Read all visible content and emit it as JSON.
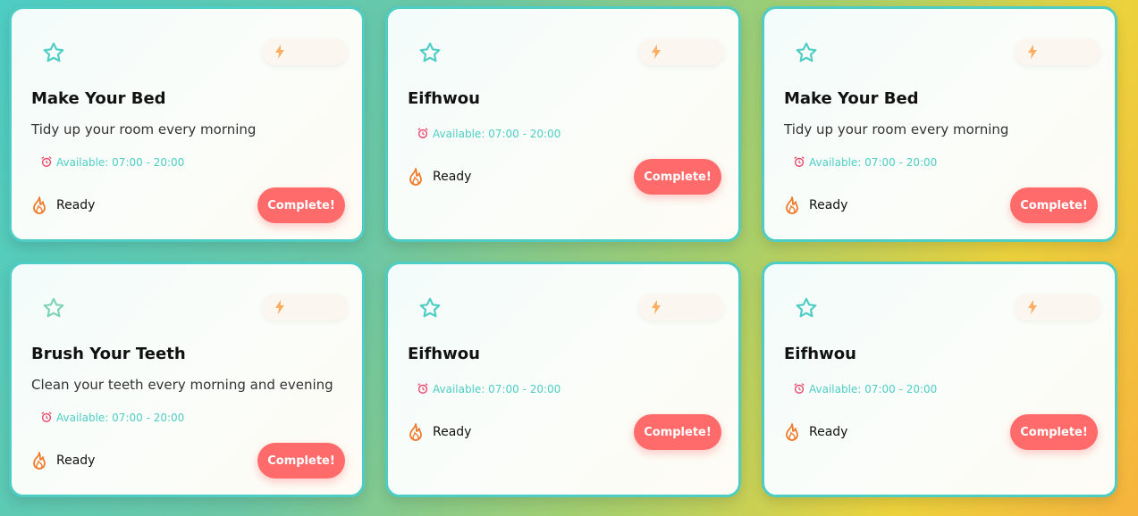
{
  "colors": {
    "accent": "#4ecdc4",
    "button": "#ff6b6b",
    "flame": "#f07b2d",
    "bolt": "#ffad60"
  },
  "icons": {
    "favorite": "star-icon",
    "points": "lightning-icon",
    "availability": "alarm-clock-icon",
    "status": "flame-icon"
  },
  "tasks": [
    {
      "title": "Make Your Bed",
      "description": "Tidy up your room every morning",
      "available": "Available: 07:00 - 20:00",
      "status": "Ready",
      "button": "Complete!"
    },
    {
      "title": "Eifhwou",
      "description": "",
      "available": "Available: 07:00 - 20:00",
      "status": "Ready",
      "button": "Complete!"
    },
    {
      "title": "Make Your Bed",
      "description": "Tidy up your room every morning",
      "available": "Available: 07:00 - 20:00",
      "status": "Ready",
      "button": "Complete!"
    },
    {
      "title": "Brush Your Teeth",
      "description": "Clean your teeth every morning and evening",
      "available": "Available: 07:00 - 20:00",
      "status": "Ready",
      "button": "Complete!"
    },
    {
      "title": "Eifhwou",
      "description": "",
      "available": "Available: 07:00 - 20:00",
      "status": "Ready",
      "button": "Complete!"
    },
    {
      "title": "Eifhwou",
      "description": "",
      "available": "Available: 07:00 - 20:00",
      "status": "Ready",
      "button": "Complete!"
    }
  ]
}
